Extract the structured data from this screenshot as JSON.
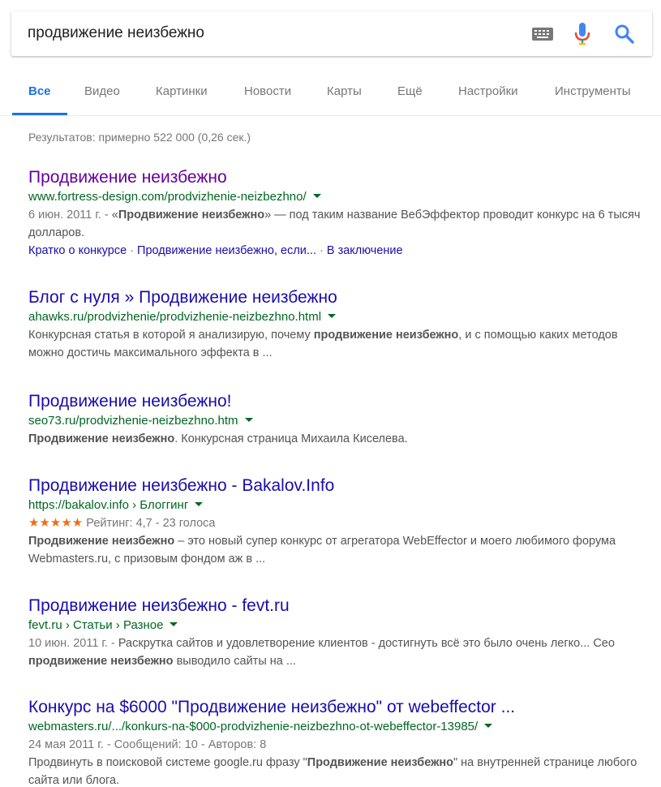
{
  "search": {
    "query": "продвижение неизбежно"
  },
  "colors": {
    "link": "#1a0dab",
    "visited": "#660099",
    "url": "#006621",
    "accent": "#1a73e8",
    "stars": "#e7711b"
  },
  "icons": {
    "keyboard": "keyboard-icon",
    "mic": "microphone-icon",
    "search": "search-icon"
  },
  "tabs": [
    {
      "label": "Все",
      "active": true
    },
    {
      "label": "Видео"
    },
    {
      "label": "Картинки"
    },
    {
      "label": "Новости"
    },
    {
      "label": "Карты"
    },
    {
      "label": "Ещё"
    },
    {
      "label": "Настройки"
    },
    {
      "label": "Инструменты"
    }
  ],
  "stats": "Результатов: примерно 522 000 (0,26 сек.)",
  "results": [
    {
      "title": "Продвижение неизбежно",
      "url": "www.fortress-design.com/prodvizhenie-neizbezhno/",
      "date": "6 июн. 2011 г. - ",
      "snippet_a": "«",
      "snippet_bold": "Продвижение неизбежно",
      "snippet_b": "» — под таким название ВебЭффектор проводит конкурс на 6 тысяч долларов.",
      "sitelinks": [
        "Кратко о конкурсе",
        "Продвижение неизбежно, если...",
        "В заключение"
      ]
    },
    {
      "title": "Блог с нуля » Продвижение неизбежно",
      "url": "ahawks.ru/prodvizhenie/prodvizhenie-neizbezhno.html",
      "snippet_a": "Конкурсная статья в которой я анализирую, почему ",
      "snippet_bold": "продвижение неизбежно",
      "snippet_b": ", и с помощью каких методов можно достичь максимального эффекта в ..."
    },
    {
      "title": "Продвижение неизбежно!",
      "url": "seo73.ru/prodvizhenie-neizbezhno.htm",
      "snippet_bold": "Продвижение неизбежно",
      "snippet_b": ". Конкурсная страница Михаила Киселева."
    },
    {
      "title": "Продвижение неизбежно - Bakalov.Info",
      "url": "https://bakalov.info › Блоггинг",
      "stars": "★★★★★",
      "rating_value": 4.7,
      "rating_text": "Рейтинг: 4,7 - 23 голоса",
      "snippet_bold": "Продвижение неизбежно",
      "snippet_b": " – это новый супер конкурс от агрегатора WebEffector и моего любимого форума Webmasters.ru, с призовым фондом аж в ..."
    },
    {
      "title": "Продвижение неизбежно - fevt.ru",
      "url": "fevt.ru › Статьи › Разное",
      "date": "10 июн. 2011 г. - ",
      "snippet_a": "Раскрутка сайтов и удовлетворение клиентов - достигнуть всё это было очень легко... Сео ",
      "snippet_bold": "продвижение неизбежно",
      "snippet_b": " выводило сайты на ..."
    },
    {
      "title": "Конкурс на $6000 \"Продвижение неизбежно\" от webeffector ...",
      "url": "webmasters.ru/.../konkurs-na-$000-prodvizhenie-neizbezhno-ot-webeffector-13985/",
      "meta": "24 мая 2011 г. - Сообщений: 10 - Авторов: 8",
      "snippet_a": "Продвинуть в поисковой системе google.ru фразу \"",
      "snippet_bold": "Продвижение неизбежно",
      "snippet_b": "\" на внутренней странице любого сайта или блога."
    }
  ]
}
